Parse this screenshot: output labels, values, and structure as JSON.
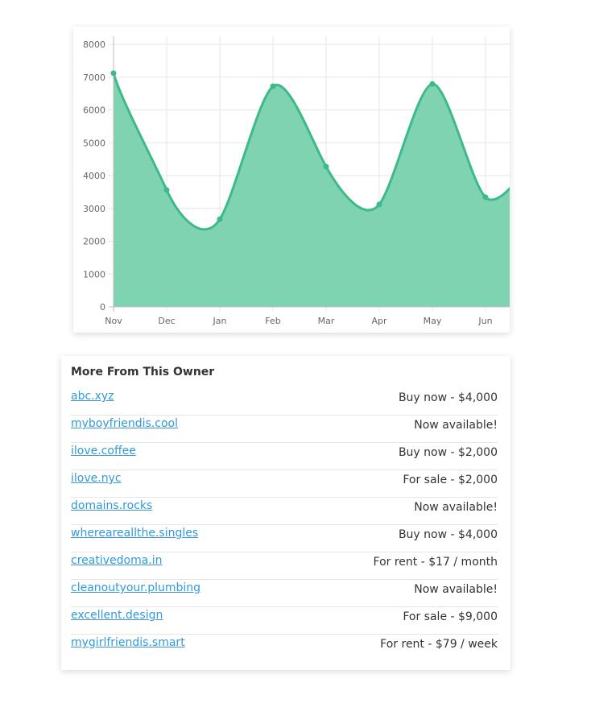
{
  "chart_data": {
    "type": "area",
    "categories": [
      "Nov",
      "Dec",
      "Jan",
      "Feb",
      "Mar",
      "Apr",
      "May",
      "Jun"
    ],
    "values": [
      7120,
      3560,
      2670,
      6720,
      4270,
      3120,
      6790,
      3340
    ],
    "y_ticks": [
      0,
      1000,
      2000,
      3000,
      4000,
      5000,
      6000,
      7000,
      8000
    ],
    "ylim": [
      0,
      8000
    ],
    "grid": true,
    "colors": {
      "line": "#3dba8b",
      "fill": "#7fd3b0",
      "grid": "#e5e5e5",
      "axis": "#bbbbbb"
    }
  },
  "owner": {
    "title": "More From This Owner",
    "items": [
      {
        "domain": "abc.xyz",
        "status": "Buy now - $4,000"
      },
      {
        "domain": "myboyfriendis.cool",
        "status": "Now available!"
      },
      {
        "domain": "ilove.coffee",
        "status": "Buy now - $2,000"
      },
      {
        "domain": "ilove.nyc",
        "status": "For sale - $2,000"
      },
      {
        "domain": "domains.rocks",
        "status": "Now available!"
      },
      {
        "domain": "whereareallthe.singles",
        "status": "Buy now - $4,000"
      },
      {
        "domain": "creativedoma.in",
        "status": "For rent - $17 / month"
      },
      {
        "domain": "cleanoutyour.plumbing",
        "status": "Now available!"
      },
      {
        "domain": "excellent.design",
        "status": "For sale - $9,000"
      },
      {
        "domain": "mygirlfriendis.smart",
        "status": "For rent - $79 / week"
      }
    ]
  }
}
